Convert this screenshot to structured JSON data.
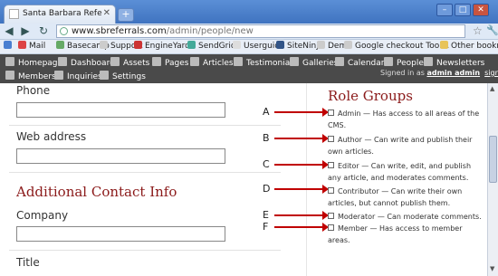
{
  "browser": {
    "tab_title": "Santa Barbara Referral Ass...",
    "url_domain": "www.sbreferrals.com",
    "url_path": "/admin/people/new",
    "bookmarks": [
      "Mail",
      "Basecamp",
      "Support",
      "EngineYard",
      "SendGrid",
      "Userguide",
      "SiteNinja",
      "Demo",
      "Google checkout Tool..."
    ],
    "other_bookmarks": "Other bookmarks"
  },
  "nav": {
    "row1": [
      "Homepage",
      "Dashboard",
      "Assets",
      "Pages",
      "Articles",
      "Testimonials",
      "Galleries",
      "Calendar",
      "People",
      "Newsletters"
    ],
    "row2": [
      "Members",
      "Inquiries",
      "Settings"
    ],
    "signed_in_prefix": "Signed in as",
    "signed_in_user": "admin admin",
    "sign_out": "sign out"
  },
  "form": {
    "phone_label": "Phone",
    "web_label": "Web address",
    "additional_heading": "Additional Contact Info",
    "company_label": "Company",
    "title_label": "Title"
  },
  "roles": {
    "heading": "Role Groups",
    "items": [
      {
        "letter": "A",
        "text": "Admin — Has access to all areas of the CMS."
      },
      {
        "letter": "B",
        "text": "Author — Can write and publish their own articles."
      },
      {
        "letter": "C",
        "text": "Editor — Can write, edit, and publish any article, and moderates comments."
      },
      {
        "letter": "D",
        "text": "Contributor — Can write their own articles, but cannot publish them."
      },
      {
        "letter": "E",
        "text": "Moderator — Can moderate comments."
      },
      {
        "letter": "F",
        "text": "Member — Has access to member areas."
      }
    ]
  },
  "colors": {
    "accent": "#8b1a1a",
    "arrow": "#c00000",
    "nav_bg": "#4a4a4a"
  }
}
